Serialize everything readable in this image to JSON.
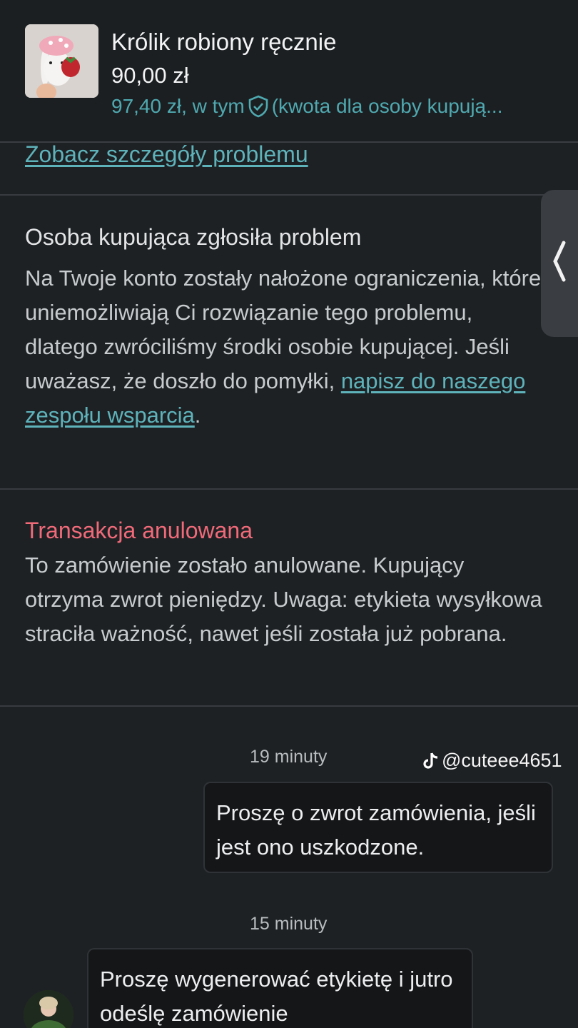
{
  "product": {
    "title": "Królik robiony ręcznie",
    "price": "90,00 zł",
    "buyer_price_prefix": "97,40 zł, w tym",
    "buyer_price_suffix": "(kwota dla osoby kupują..."
  },
  "details_link": "Zobacz szczegóły problemu",
  "problem": {
    "heading": "Osoba kupująca zgłosiła problem",
    "body_text": "Na Twoje konto zostały nałożone ograniczenia, które uniemożliwiają Ci rozwiązanie tego problemu, dlatego zwróciliśmy środki osobie kupującej. Jeśli uważasz, że doszło do pomyłki, ",
    "support_link": "napisz do naszego zespołu wsparcia",
    "body_end": "."
  },
  "cancelled": {
    "heading": "Transakcja anulowana",
    "body": "To zamówienie zostało anulowane. Kupujący otrzyma zwrot pieniędzy. Uwaga: etykieta wysyłkowa straciła ważność, nawet jeśli została już pobrana."
  },
  "messages": [
    {
      "time": "19 minuty",
      "text": "Proszę o zwrot zamówienia, jeśli jest ono uszkodzone.",
      "direction": "outgoing"
    },
    {
      "time": "15 minuty",
      "text": "Proszę wygenerować etykietę i jutro odeślę zamówienie",
      "direction": "incoming"
    }
  ],
  "watermark": "@cuteee4651",
  "colors": {
    "background": "#1e2124",
    "accent_link": "#5eb3bb",
    "cancel_red": "#f06a79"
  },
  "icons": {
    "protection": "shield-check-icon",
    "side_tab": "chevron-left-icon",
    "watermark": "tiktok-logo-icon"
  }
}
